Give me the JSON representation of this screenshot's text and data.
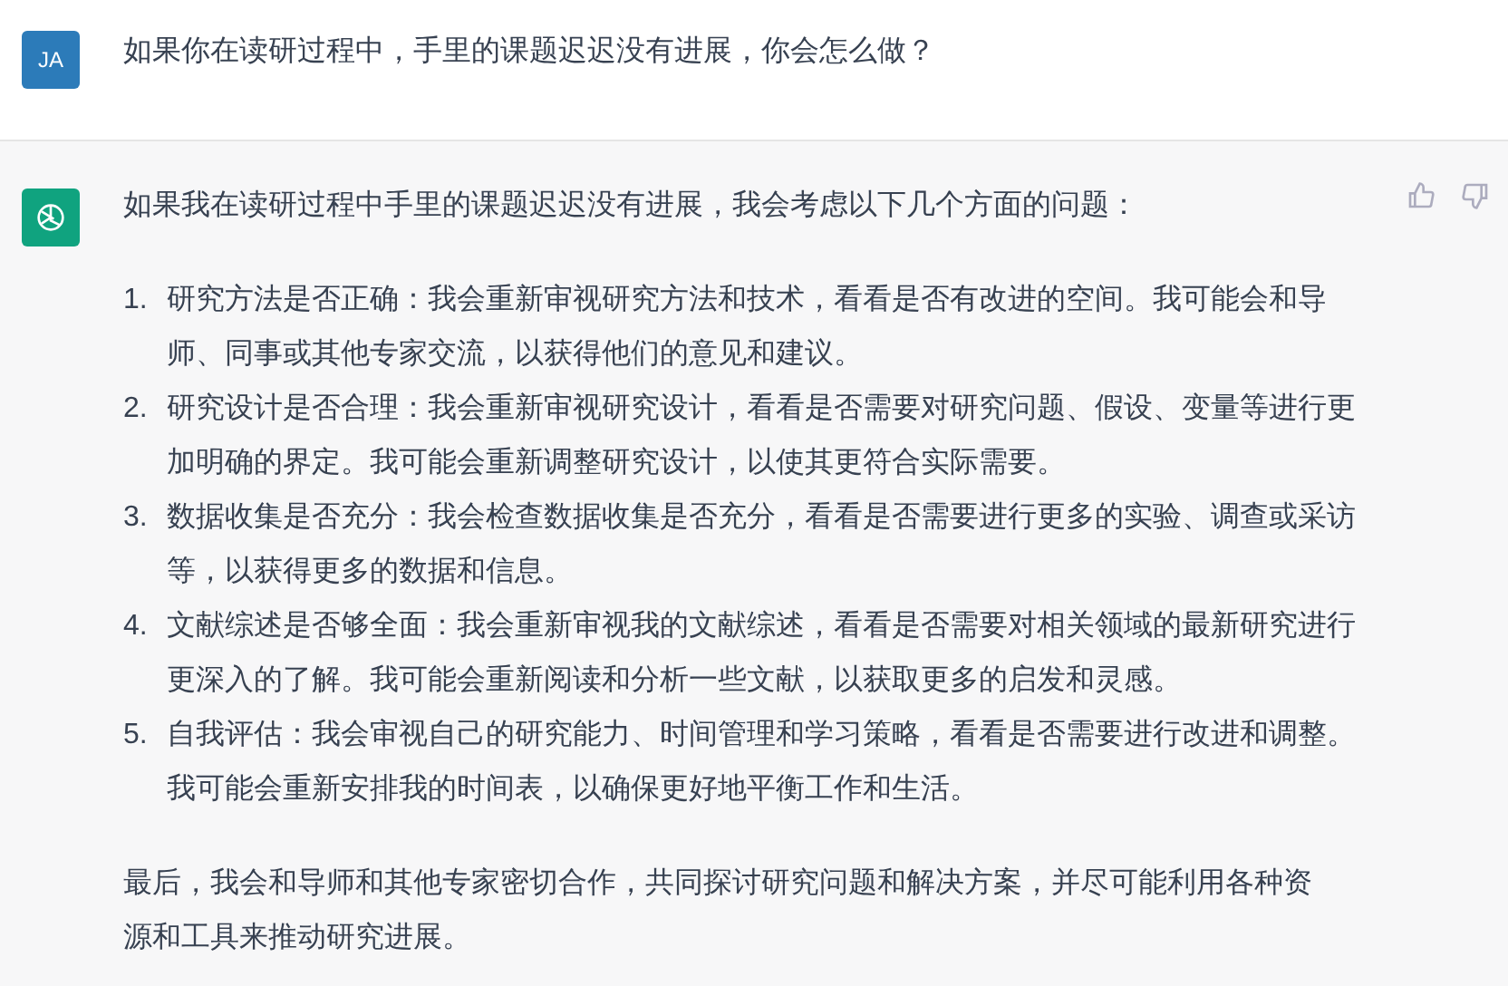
{
  "user_message": {
    "avatar": "JA",
    "text": "如果你在读研过程中，手里的课题迟迟没有进展，你会怎么做？"
  },
  "assistant_message": {
    "intro": "如果我在读研过程中手里的课题迟迟没有进展，我会考虑以下几个方面的问题：",
    "items": [
      {
        "number": "1.",
        "text": "研究方法是否正确：我会重新审视研究方法和技术，看看是否有改进的空间。我可能会和导师、同事或其他专家交流，以获得他们的意见和建议。"
      },
      {
        "number": "2.",
        "text": "研究设计是否合理：我会重新审视研究设计，看看是否需要对研究问题、假设、变量等进行更加明确的界定。我可能会重新调整研究设计，以使其更符合实际需要。"
      },
      {
        "number": "3.",
        "text": "数据收集是否充分：我会检查数据收集是否充分，看看是否需要进行更多的实验、调查或采访等，以获得更多的数据和信息。"
      },
      {
        "number": "4.",
        "text": "文献综述是否够全面：我会重新审视我的文献综述，看看是否需要对相关领域的最新研究进行更深入的了解。我可能会重新阅读和分析一些文献，以获取更多的启发和灵感。"
      },
      {
        "number": "5.",
        "text": "自我评估：我会审视自己的研究能力、时间管理和学习策略，看看是否需要进行改进和调整。我可能会重新安排我的时间表，以确保更好地平衡工作和生活。"
      }
    ],
    "conclusion": "最后，我会和导师和其他专家密切合作，共同探讨研究问题和解决方案，并尽可能利用各种资源和工具来推动研究进展。"
  }
}
